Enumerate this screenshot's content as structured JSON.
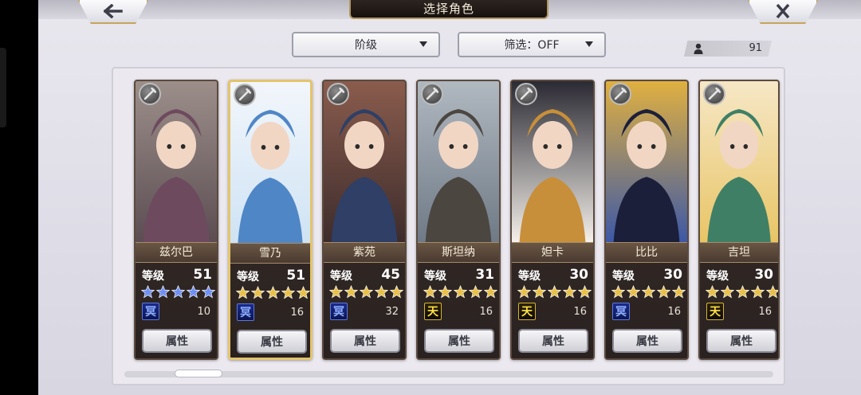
{
  "header": {
    "title": "选择角色"
  },
  "nav": {
    "back_icon": "arrow-left-icon",
    "close_icon": "close-x-icon"
  },
  "filters": {
    "rank_label": "阶级",
    "filter_label": "筛选：OFF"
  },
  "roster": {
    "count": "91"
  },
  "colors": {
    "star_blue": "#6f8ff2",
    "star_gold": "#e8c04a",
    "selected_border": "#e4c46d"
  },
  "cards": [
    {
      "name": "兹尔巴",
      "level_label": "等级",
      "level": "51",
      "star_color": "blue",
      "crystal_type": "blue",
      "crystal_glyph": "冥",
      "crystal_count": "10",
      "attr_label": "属性",
      "weapon_icon": "weapon-icon",
      "selected": false
    },
    {
      "name": "雪乃",
      "level_label": "等级",
      "level": "51",
      "star_color": "gold",
      "crystal_type": "blue",
      "crystal_glyph": "冥",
      "crystal_count": "16",
      "attr_label": "属性",
      "weapon_icon": "weapon-icon",
      "selected": true
    },
    {
      "name": "紫苑",
      "level_label": "等级",
      "level": "45",
      "star_color": "gold",
      "crystal_type": "blue",
      "crystal_glyph": "冥",
      "crystal_count": "32",
      "attr_label": "属性",
      "weapon_icon": "weapon-icon",
      "selected": false
    },
    {
      "name": "斯坦纳",
      "level_label": "等级",
      "level": "31",
      "star_color": "gold",
      "crystal_type": "gold",
      "crystal_glyph": "天",
      "crystal_count": "16",
      "attr_label": "属性",
      "weapon_icon": "weapon-icon",
      "selected": false
    },
    {
      "name": "妲卡",
      "level_label": "等级",
      "level": "30",
      "star_color": "gold",
      "crystal_type": "gold",
      "crystal_glyph": "天",
      "crystal_count": "16",
      "attr_label": "属性",
      "weapon_icon": "weapon-icon",
      "selected": false
    },
    {
      "name": "比比",
      "level_label": "等级",
      "level": "30",
      "star_color": "gold",
      "crystal_type": "blue",
      "crystal_glyph": "冥",
      "crystal_count": "16",
      "attr_label": "属性",
      "weapon_icon": "weapon-icon",
      "selected": false
    },
    {
      "name": "吉坦",
      "level_label": "等级",
      "level": "30",
      "star_color": "gold",
      "crystal_type": "gold",
      "crystal_glyph": "天",
      "crystal_count": "16",
      "attr_label": "属性",
      "weapon_icon": "weapon-icon",
      "selected": false
    }
  ]
}
